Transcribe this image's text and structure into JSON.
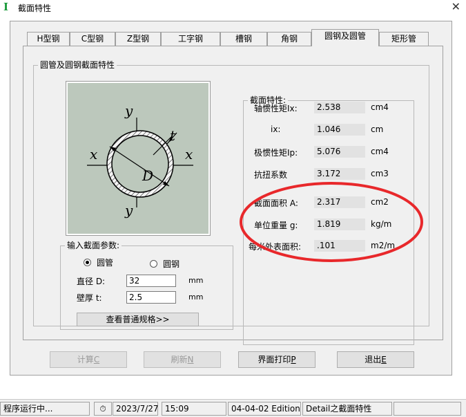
{
  "window": {
    "title": "截面特性"
  },
  "tabs": [
    "H型钢",
    "C型钢",
    "Z型钢",
    "工字钢",
    "槽钢",
    "角钢",
    "圆钢及圆管",
    "矩形管"
  ],
  "section_group": {
    "title": "圆管及圆钢截面特性"
  },
  "figure": {
    "y_top": "y",
    "y_bottom": "y",
    "x_left": "x",
    "x_right": "x",
    "t_label": "t",
    "d_label": "D"
  },
  "input_group": {
    "title": "输入截面参数:",
    "radio_tube": "圆管",
    "radio_rod": "圆钢",
    "selected": "圆管",
    "diameter_label": "直径 D:",
    "diameter_value": "32",
    "diameter_unit": "mm",
    "thickness_label": "壁厚 t:",
    "thickness_value": "2.5",
    "thickness_unit": "mm",
    "spec_button": "查看普通规格>>"
  },
  "props_group": {
    "title": "截面特性:",
    "rows": [
      {
        "label": "轴惯性矩Ix:",
        "value": "2.538",
        "unit": "cm4"
      },
      {
        "label": "ix:",
        "value": "1.046",
        "unit": "cm"
      },
      {
        "label": "极惯性矩Ip:",
        "value": "5.076",
        "unit": "cm4"
      },
      {
        "label": "抗扭系数",
        "value": "3.172",
        "unit": "cm3"
      },
      {
        "label": "截面面积 A:",
        "value": "2.317",
        "unit": "cm2"
      },
      {
        "label": "单位重量 g:",
        "value": "1.819",
        "unit": "kg/m"
      },
      {
        "label": "每米外表面积:",
        "value": ".101",
        "unit": "m2/m"
      }
    ]
  },
  "buttons": {
    "calc": {
      "label": "计算",
      "key": "C"
    },
    "refresh": {
      "label": "刷新",
      "key": "N"
    },
    "print": {
      "label": "界面打印",
      "key": "P"
    },
    "exit": {
      "label": "退出",
      "key": "E"
    }
  },
  "statusbar": {
    "status": "程序运行中...",
    "date": "2023/7/27",
    "time": "15:09",
    "edition": "04-04-02 Edition",
    "detail": "Detail之截面特性"
  },
  "colors": {
    "annotation_ellipse": "#e8282b",
    "figure_bg": "#bcc8bc"
  }
}
